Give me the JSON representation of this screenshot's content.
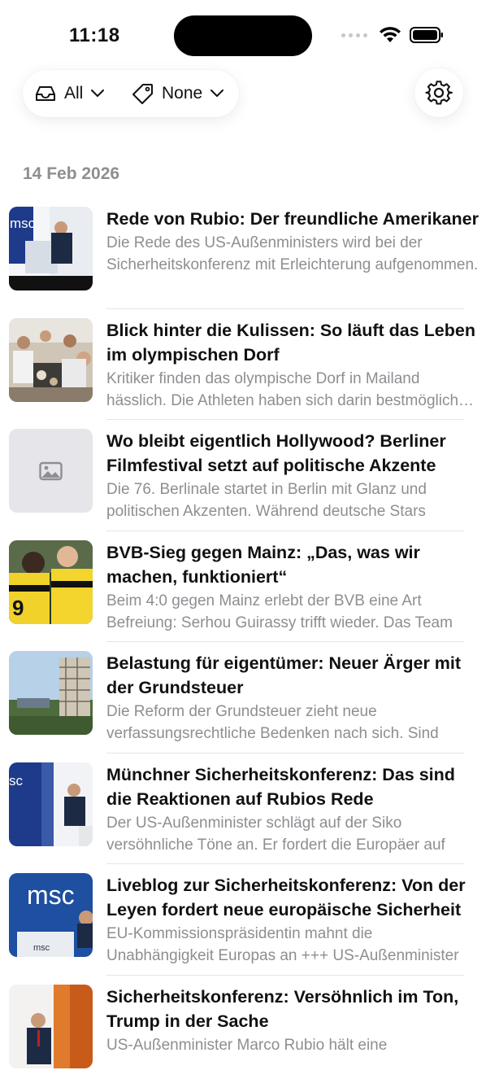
{
  "status": {
    "time": "11:18"
  },
  "filters": {
    "inbox": {
      "label": "All",
      "icon": "tray-icon"
    },
    "tag": {
      "label": "None",
      "icon": "tag-icon"
    },
    "settings_icon": "gear-icon"
  },
  "date_header": "14 Feb 2026",
  "articles": [
    {
      "title": "Rede von Rubio: Der freundliche Amerikaner",
      "summary": "Die Rede des US-Außenministers wird bei der Sicherheitskonferenz mit Erleichterung aufgenommen."
    },
    {
      "title": "Blick hinter die Kulissen: So läuft das Leben im olympischen Dorf",
      "summary": "Kritiker finden das olympische Dorf in Mailand hässlich. Die Athleten haben sich darin bestmöglich eingerichtet."
    },
    {
      "title": "Wo bleibt eigentlich Hollywood? Berliner Filmfestival setzt auf politische Akzente",
      "summary": "Die 76. Berlinale startet in Berlin mit Glanz und politischen Akzenten. Während deutsche Stars"
    },
    {
      "title": "BVB-Sieg gegen Mainz: „Das, was wir machen, funktioniert“",
      "summary": "Beim 4:0 gegen Mainz erlebt der BVB eine Art Befreiung: Serhou Guirassy trifft wieder. Das Team"
    },
    {
      "title": "Belastung für eigentümer: Neuer Ärger mit der Grundsteuer",
      "summary": "Die Reform der Grundsteuer zieht neue verfassungsrechtliche Bedenken nach sich. Sind"
    },
    {
      "title": "Münchner Sicherheitskonferenz: Das sind die Reaktionen auf Rubios Rede",
      "summary": "Der US-Außenminister schlägt auf der Siko versöhnliche Töne an. Er fordert die Europäer auf"
    },
    {
      "title": "Liveblog zur Sicherheitskonferenz: Von der Leyen fordert neue europäische Sicherheit",
      "summary": "EU-Kommissionspräsidentin mahnt die Unabhängigkeit Europas an +++ US-Außenminister"
    },
    {
      "title": "Sicherheitskonferenz: Versöhnlich im Ton, Trump in der Sache",
      "summary": "US-Außenminister Marco Rubio hält eine"
    }
  ],
  "thumb_texts": {
    "msc": "msc"
  }
}
